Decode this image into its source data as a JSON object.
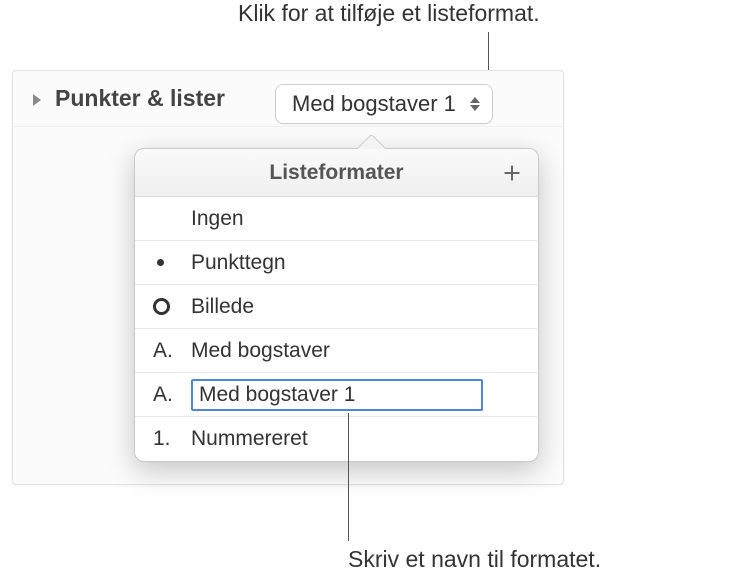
{
  "callouts": {
    "top": "Klik for at tilføje et listeformat.",
    "bottom": "Skriv et navn til formatet."
  },
  "section_label": "Punkter & lister",
  "dropdown_value": "Med bogstaver 1",
  "popover": {
    "title": "Listeformater",
    "items": [
      {
        "marker_type": "none",
        "marker": "",
        "label": "Ingen"
      },
      {
        "marker_type": "bullet",
        "marker": "•",
        "label": "Punkttegn"
      },
      {
        "marker_type": "circle",
        "marker": "○",
        "label": "Billede"
      },
      {
        "marker_type": "letter",
        "marker": "A.",
        "label": "Med bogstaver"
      },
      {
        "marker_type": "letter",
        "marker": "A.",
        "label": "Med bogstaver 1",
        "editing": true
      },
      {
        "marker_type": "number",
        "marker": "1.",
        "label": "Nummereret"
      }
    ]
  }
}
